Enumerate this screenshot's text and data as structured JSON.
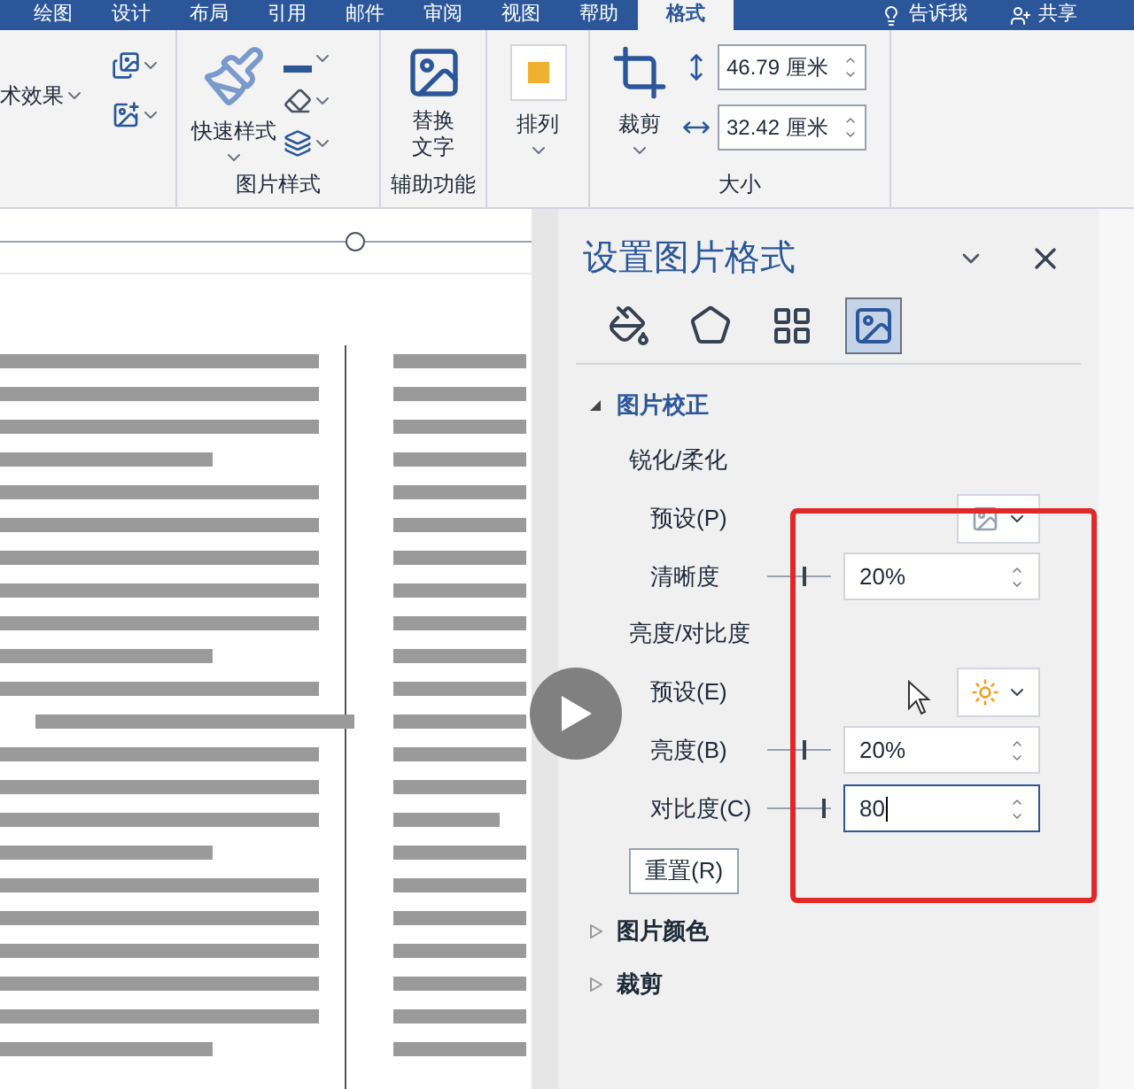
{
  "ribbon": {
    "tabs": [
      {
        "label": "绘图",
        "selected": false
      },
      {
        "label": "设计",
        "selected": false
      },
      {
        "label": "布局",
        "selected": false
      },
      {
        "label": "引用",
        "selected": false
      },
      {
        "label": "邮件",
        "selected": false
      },
      {
        "label": "审阅",
        "selected": false
      },
      {
        "label": "视图",
        "selected": false
      },
      {
        "label": "帮助",
        "selected": false
      },
      {
        "label": "格式",
        "selected": true
      }
    ],
    "tell_me": "告诉我",
    "share": "共享",
    "adjust": {
      "effects": "术效果"
    },
    "picture_styles": {
      "quick_styles": "快速样式",
      "label": "图片样式"
    },
    "accessibility": {
      "alt_text": [
        "替换",
        "文字"
      ],
      "label": "辅助功能"
    },
    "arrange": {
      "label": "排列"
    },
    "size": {
      "crop": "裁剪",
      "height": "46.79 厘米",
      "width": "32.42 厘米",
      "label": "大小"
    }
  },
  "panel": {
    "title": "设置图片格式",
    "tabs": [
      {
        "kind": "fill",
        "selected": false
      },
      {
        "kind": "effects",
        "selected": false
      },
      {
        "kind": "layout",
        "selected": false
      },
      {
        "kind": "picture",
        "selected": true
      }
    ],
    "sections": [
      {
        "title": "图片校正",
        "expanded": true,
        "rows": [
          {
            "kind": "heading",
            "label": "锐化/柔化"
          },
          {
            "kind": "preset",
            "label": "预设(P)"
          },
          {
            "kind": "slider",
            "label": "清晰度",
            "level": 0.6,
            "value": "20%",
            "focused": false
          },
          {
            "kind": "heading",
            "label": "亮度/对比度"
          },
          {
            "kind": "preset",
            "label": "预设(E)"
          },
          {
            "kind": "slider",
            "label": "亮度(B)",
            "level": 0.6,
            "value": "20%",
            "focused": false
          },
          {
            "kind": "slider",
            "label": "对比度(C)",
            "level": 0.9,
            "value": "80",
            "focused": true
          },
          {
            "kind": "button",
            "label": "重置(R)"
          }
        ]
      },
      {
        "title": "图片颜色",
        "expanded": false
      },
      {
        "title": "裁剪",
        "expanded": false
      }
    ]
  }
}
